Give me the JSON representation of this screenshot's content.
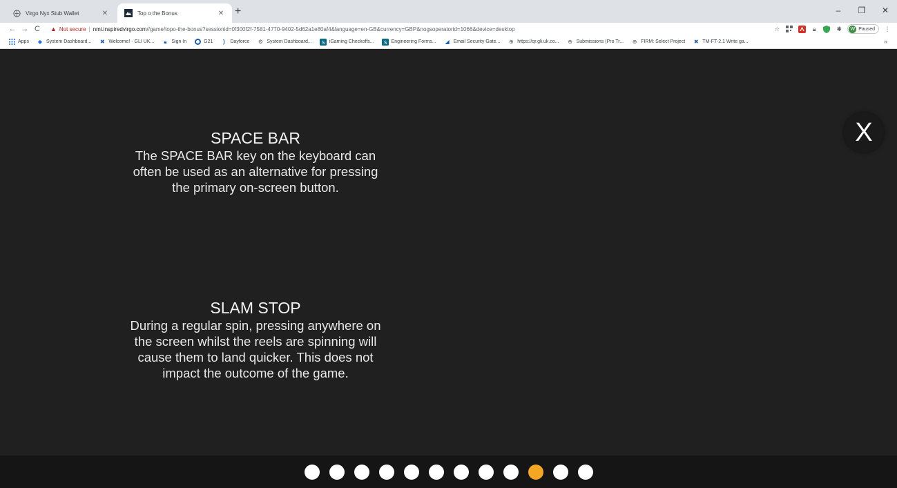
{
  "browser": {
    "tabs": [
      {
        "title": "Virgo Nyx Stub Wallet",
        "active": false
      },
      {
        "title": "Top o the Bonus",
        "active": true
      }
    ],
    "new_tab": "+",
    "window_controls": {
      "minimize": "–",
      "restore": "❐",
      "close": "✕"
    },
    "nav": {
      "back": "←",
      "forward": "→",
      "reload": "C"
    },
    "address": {
      "warning_label": "Not secure",
      "separator": "|",
      "host": "nmi.inspiredvirgo.com",
      "path": "//game/topo-the-bonus?sessionid=0f300f2f-7581-4770-9402-5d62a1e80af4&language=en-GB&currency=GBP&nogsoperatorid=1066&device=desktop"
    },
    "profile": {
      "initial": "W",
      "status": "Paused"
    },
    "menu": "⋮",
    "bookmarks": [
      {
        "label": "Apps",
        "icon": "apps-grid-icon"
      },
      {
        "label": "System Dashboard...",
        "icon": "diamond-icon"
      },
      {
        "label": "Welcome! - GLI UK...",
        "icon": "gli-icon"
      },
      {
        "label": "Sign In",
        "icon": "lock-icon"
      },
      {
        "label": "G21",
        "icon": "g21-icon"
      },
      {
        "label": "Dayforce",
        "icon": "dayforce-icon"
      },
      {
        "label": "System Dashboard...",
        "icon": "gear-icon"
      },
      {
        "label": "iGaming Checkoffs...",
        "icon": "sharepoint-icon"
      },
      {
        "label": "Engineering Forms...",
        "icon": "sharepoint-icon"
      },
      {
        "label": "Email Security Gate...",
        "icon": "mail-gate-icon"
      },
      {
        "label": "https://qr.gli.uk.co...",
        "icon": "globe-icon"
      },
      {
        "label": "Submissions (Pro Tr...",
        "icon": "globe-icon"
      },
      {
        "label": "FIRM: Select Project",
        "icon": "globe-icon"
      },
      {
        "label": "TM-FT-2.1 Write ga...",
        "icon": "gli-icon"
      }
    ],
    "bookmarks_more": "»"
  },
  "game": {
    "sections": [
      {
        "title": "SPACE BAR",
        "lines": [
          "The SPACE BAR key on the keyboard can",
          "often be used as an alternative for pressing",
          "the primary on-screen button."
        ]
      },
      {
        "title": "SLAM STOP",
        "lines": [
          "During a regular spin, pressing anywhere on",
          "the screen whilst the reels are spinning will",
          "cause them to land quicker. This does not",
          "impact the outcome of the game."
        ]
      }
    ],
    "close_label": "X",
    "pagination": {
      "total": 12,
      "current": 10
    },
    "colors": {
      "background": "#202020",
      "pager_bg": "#151515",
      "dot": "#ffffff",
      "dot_active": "#f5a623"
    }
  }
}
